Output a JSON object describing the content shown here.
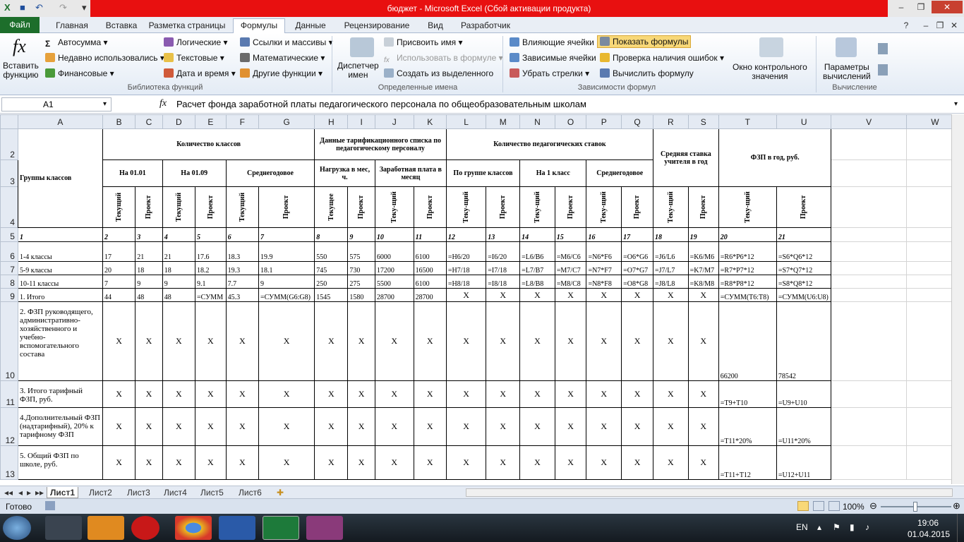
{
  "window": {
    "title": "бюджет - Microsoft Excel (Сбой активации продукта)"
  },
  "tabs": [
    "Файл",
    "Главная",
    "Вставка",
    "Разметка страницы",
    "Формулы",
    "Данные",
    "Рецензирование",
    "Вид",
    "Разработчик"
  ],
  "ribbon": {
    "insert_function": "Вставить\nфункцию",
    "lib": {
      "autosum": "Автосумма",
      "recent": "Недавно использовались",
      "financial": "Финансовые",
      "logical": "Логические",
      "text": "Текстовые",
      "datetime": "Дата и время",
      "lookup": "Ссылки и массивы",
      "math": "Математические",
      "other": "Другие функции",
      "group": "Библиотека функций"
    },
    "names": {
      "manager": "Диспетчер\nимен",
      "assign": "Присвоить имя",
      "use": "Использовать в формуле",
      "create": "Создать из выделенного",
      "group": "Определенные имена"
    },
    "audit": {
      "precedents": "Влияющие ячейки",
      "dependents": "Зависимые ячейки",
      "remove": "Убрать стрелки",
      "show": "Показать формулы",
      "errors": "Проверка наличия ошибок",
      "evaluate": "Вычислить формулу",
      "group": "Зависимости формул"
    },
    "watch": "Окно контрольного\nзначения",
    "calc": {
      "options": "Параметры\nвычислений",
      "group": "Вычисление"
    }
  },
  "formula_bar": {
    "name_box": "A1",
    "fx": "fx",
    "content": "Расчет фонда заработной платы педагогического персонала по общеобразовательным школам"
  },
  "columns": [
    "A",
    "B",
    "C",
    "D",
    "E",
    "F",
    "G",
    "H",
    "I",
    "J",
    "K",
    "L",
    "M",
    "N",
    "O",
    "P",
    "Q",
    "R",
    "S",
    "T",
    "U",
    "V",
    "W"
  ],
  "rows": [
    "2",
    "3",
    "4",
    "5",
    "6",
    "7",
    "8",
    "9",
    "10",
    "11",
    "12",
    "13"
  ],
  "headers": {
    "a2": "Группы классов",
    "b2": "Количество классов",
    "h2": "Данные тарификационного  списка по педагогическому персоналу",
    "l2": "Количество педагогических ставок",
    "r2": "Средняя ставка учителя в год",
    "t2": "ФЗП в год, руб.",
    "b3": "На 01.01",
    "d3": "На 01.09",
    "f3": "Среднегодовое",
    "h3": "Нагрузка в мес, ч.",
    "j3": "Заработная плата в месяц",
    "l3": "По группе классов",
    "n3": "На 1 класс",
    "p3": "Среднегодовое",
    "r4": "Теку-щий",
    "s4": "Проект"
  },
  "row4": [
    "Текущий",
    "Проект",
    "Текущий",
    "Проект",
    "Текущий",
    "Проект",
    "Текущее",
    "Проект",
    "Теку-щий",
    "Проект",
    "Теку-щий",
    "Проект",
    "Теку-щий",
    "Проект",
    "Теку-щий",
    "Проект",
    "Теку-щий",
    "Проект",
    "Теку-щий",
    "Проект"
  ],
  "row5": [
    "1",
    "2",
    "3",
    "4",
    "5",
    "6",
    "7",
    "8",
    "9",
    "10",
    "11",
    "12",
    "13",
    "14",
    "15",
    "16",
    "17",
    "18",
    "19",
    "20",
    "21"
  ],
  "data": [
    [
      "1-4 классы",
      "17",
      "21",
      "21",
      "17.6",
      "18.3",
      "19.9",
      "550",
      "575",
      "6000",
      "6100",
      "=H6/20",
      "=I6/20",
      "=L6/B6",
      "=M6/C6",
      "=N6*F6",
      "=O6*G6",
      "=J6/L6",
      "=K6/M6",
      "=R6*P6*12",
      "=S6*Q6*12"
    ],
    [
      "5-9 классы",
      "20",
      "18",
      "18",
      "18.2",
      "19.3",
      "18.1",
      "745",
      "730",
      "17200",
      "16500",
      "=H7/18",
      "=I7/18",
      "=L7/B7",
      "=M7/C7",
      "=N7*F7",
      "=O7*G7",
      "=J7/L7",
      "=K7/M7",
      "=R7*P7*12",
      "=S7*Q7*12"
    ],
    [
      "10-11 классы",
      "7",
      "9",
      "9",
      "9.1",
      "7.7",
      "9",
      "250",
      "275",
      "5500",
      "6100",
      "=H8/18",
      "=I8/18",
      "=L8/B8",
      "=M8/C8",
      "=N8*F8",
      "=O8*G8",
      "=J8/L8",
      "=K8/M8",
      "=R8*P8*12",
      "=S8*Q8*12"
    ],
    [
      "1. Итого",
      "44",
      "48",
      "48",
      "=СУММ",
      "45.3",
      "=СУММ(G6:G8)",
      "1545",
      "1580",
      "28700",
      "28700",
      "X",
      "X",
      "X",
      "X",
      "X",
      "X",
      "X",
      "X",
      "=СУММ(T6:T8)",
      "=СУММ(U6:U8)"
    ]
  ],
  "tall_rows": [
    {
      "label": "2. ФЗП руководящего, административно-хозяйственного и учебно-вспомогательного состава",
      "t": "66200",
      "u": "78542"
    },
    {
      "label": "3. Итого тарифный ФЗП, руб.",
      "t": "=T9+T10",
      "u": "=U9+U10"
    },
    {
      "label": "4.Дополнительный ФЗП (надтарифный), 20% к тарифному ФЗП",
      "t": "=T11*20%",
      "u": "=U11*20%"
    },
    {
      "label": "5. Общий ФЗП по школе, руб.",
      "t": "=T11+T12",
      "u": "=U12+U11"
    }
  ],
  "x_mark": "X",
  "sheets": [
    "Лист1",
    "Лист2",
    "Лист3",
    "Лист4",
    "Лист5",
    "Лист6"
  ],
  "status": {
    "ready": "Готово",
    "zoom": "100%"
  },
  "tray": {
    "lang": "EN",
    "time": "19:06",
    "date": "01.04.2015"
  }
}
